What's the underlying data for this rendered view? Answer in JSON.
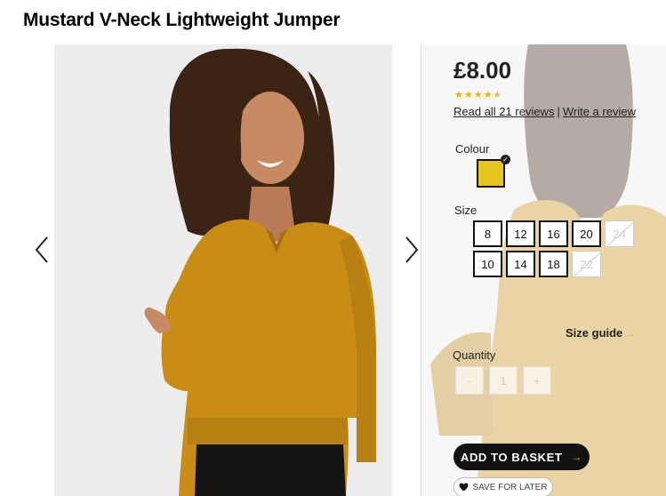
{
  "product": {
    "title": "Mustard V-Neck Lightweight Jumper"
  },
  "gallery": {
    "prev_icon": "chevron-left-icon",
    "next_icon": "chevron-right-icon"
  },
  "details": {
    "price": "£8.00",
    "rating": 4.5,
    "rating_max": 5,
    "reviews_link": "Read all 21 reviews",
    "separator": "|",
    "write_review_link": "Write a review",
    "colour_label": "Colour",
    "selected_colour": "#e6c51f",
    "size_label": "Size",
    "sizes": [
      {
        "label": "8",
        "available": true
      },
      {
        "label": "12",
        "available": true
      },
      {
        "label": "16",
        "available": true
      },
      {
        "label": "20",
        "available": true
      },
      {
        "label": "24",
        "available": false
      },
      {
        "label": "10",
        "available": true
      },
      {
        "label": "14",
        "available": true
      },
      {
        "label": "18",
        "available": true
      },
      {
        "label": "22",
        "available": false
      }
    ],
    "size_guide_label": "Size guide",
    "quantity_label": "Quantity",
    "quantity_minus": "-",
    "quantity_value": "1",
    "quantity_plus": "+",
    "add_to_basket_label": "ADD TO BASKET",
    "save_for_later_label": "SAVE FOR LATER"
  },
  "colors": {
    "accent": "#f0b400",
    "jumper": "#c98c14",
    "button_dark": "#111111"
  }
}
